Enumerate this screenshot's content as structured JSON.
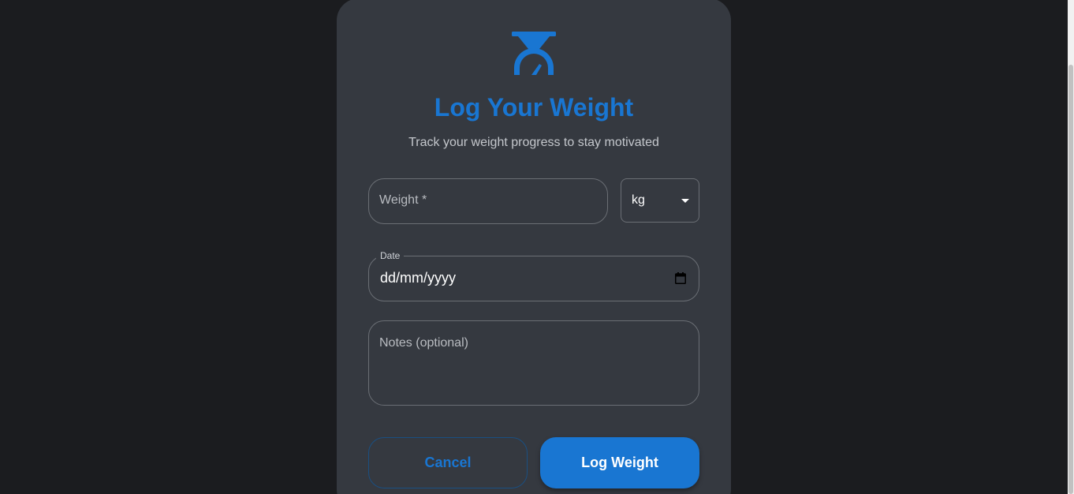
{
  "header": {
    "logo_icon": "scale-icon",
    "title": "Log Your Weight",
    "subtitle": "Track your weight progress to stay motivated"
  },
  "form": {
    "weight": {
      "label": "Weight *",
      "value": ""
    },
    "unit": {
      "selected": "kg",
      "icon": "caret-down-icon"
    },
    "date": {
      "label": "Date",
      "value": "dd/mm/yyyy",
      "icon": "calendar-icon"
    },
    "notes": {
      "placeholder": "Notes (optional)",
      "value": ""
    }
  },
  "actions": {
    "cancel_label": "Cancel",
    "submit_label": "Log Weight"
  },
  "colors": {
    "accent": "#1976d2",
    "card_background": "#353940",
    "page_background": "#1b1c1f"
  }
}
